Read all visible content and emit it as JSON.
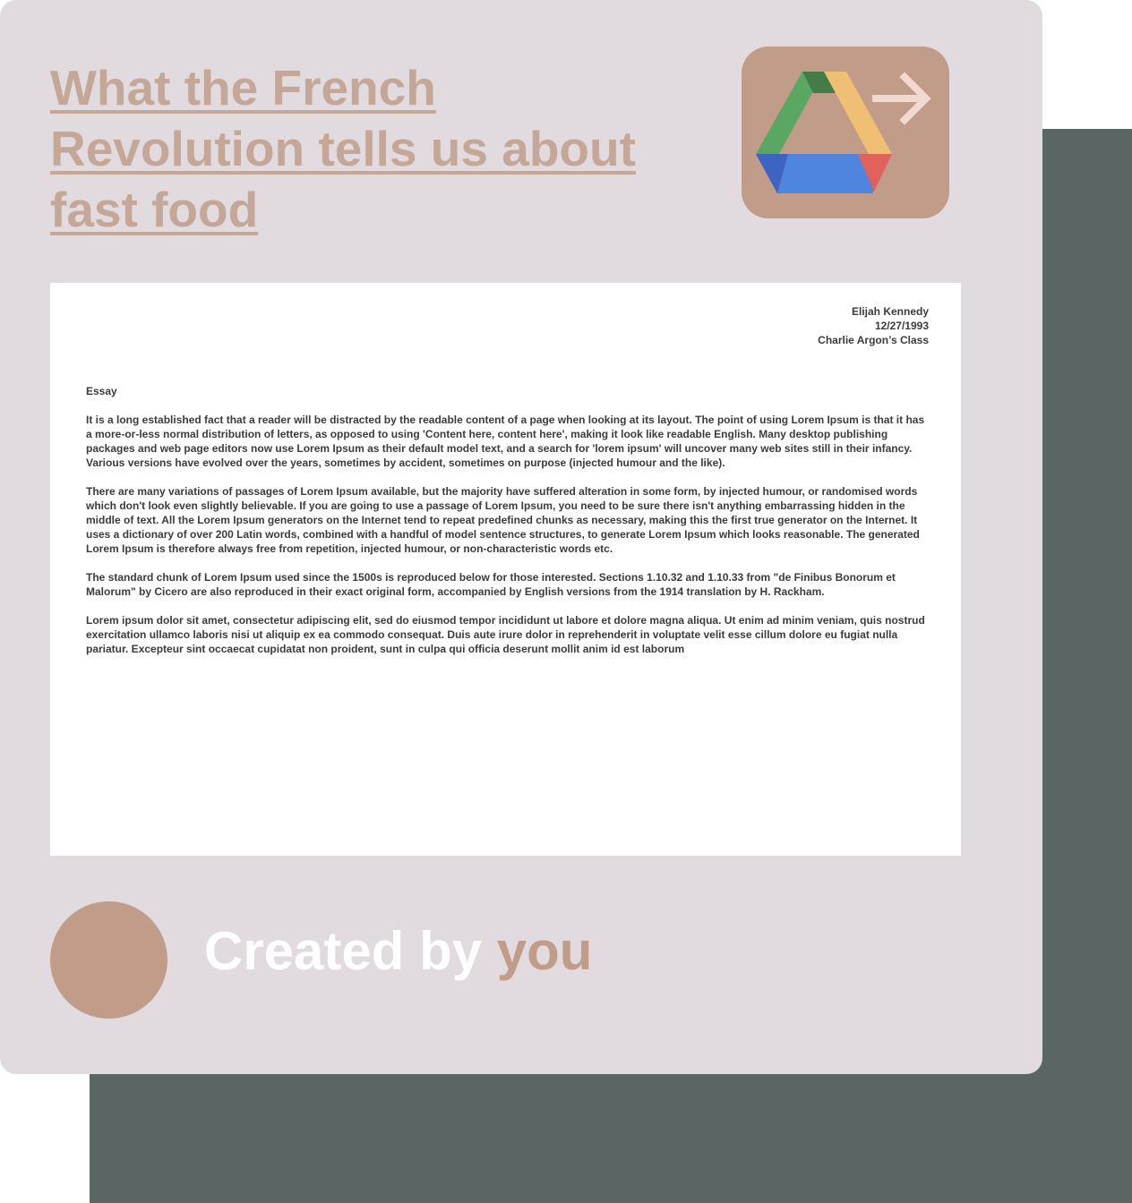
{
  "title": {
    "line1": "What the French",
    "line2": "Revolution tells us about",
    "line3": "fast food"
  },
  "drive_button": {
    "icon": "google-drive-icon",
    "arrow_icon": "arrow-right-icon"
  },
  "document": {
    "author": "Elijah Kennedy",
    "date": "12/27/1993",
    "class": "Charlie Argon’s Class",
    "label": "Essay",
    "paragraphs": [
      "It is a long established fact that a reader will be distracted by the readable content of a page when looking at its layout. The point of using Lorem Ipsum is that it has a more-or-less normal distribution of letters, as opposed to using 'Content here, content here', making it look like readable English. Many desktop publishing packages and web page editors now use Lorem Ipsum as their default model text, and a search for 'lorem ipsum' will uncover many web sites still in their infancy. Various versions have evolved over the years, sometimes by accident, sometimes on purpose (injected humour and the like).",
      "There are many variations of passages of Lorem Ipsum available, but the majority have suffered alteration in some form, by injected humour, or randomised words which don't look even slightly believable. If you are going to use a passage of Lorem Ipsum, you need to be sure there isn't anything embarrassing hidden in the middle of text. All the Lorem Ipsum generators on the Internet tend to repeat predefined chunks as necessary, making this the first true generator on the Internet. It uses a dictionary of over 200 Latin words, combined with a handful of model sentence structures, to generate Lorem Ipsum which looks reasonable. The generated Lorem Ipsum is therefore always free from repetition, injected humour, or non-characteristic words etc.",
      "The standard chunk of Lorem Ipsum used since the 1500s is reproduced below for those interested. Sections 1.10.32 and 1.10.33 from \"de Finibus Bonorum et Malorum\" by Cicero are also reproduced in their exact original form, accompanied by English versions from the 1914 translation by H. Rackham.",
      "Lorem ipsum dolor sit amet, consectetur adipiscing elit, sed do eiusmod tempor incididunt ut labore et dolore magna aliqua. Ut enim ad minim veniam, quis nostrud exercitation ullamco laboris nisi ut aliquip ex ea commodo consequat. Duis aute irure dolor in reprehenderit in voluptate velit esse cillum dolore eu fugiat nulla pariatur. Excepteur sint occaecat cupidatat non proident, sunt in culpa qui officia deserunt mollit anim id est laborum"
    ]
  },
  "footer": {
    "created_by": "Created by ",
    "you": "you"
  },
  "colors": {
    "card_background": "#e1dadf",
    "backdrop": "#5a6664",
    "accent": "#c09c89",
    "title": "#c5a797"
  }
}
